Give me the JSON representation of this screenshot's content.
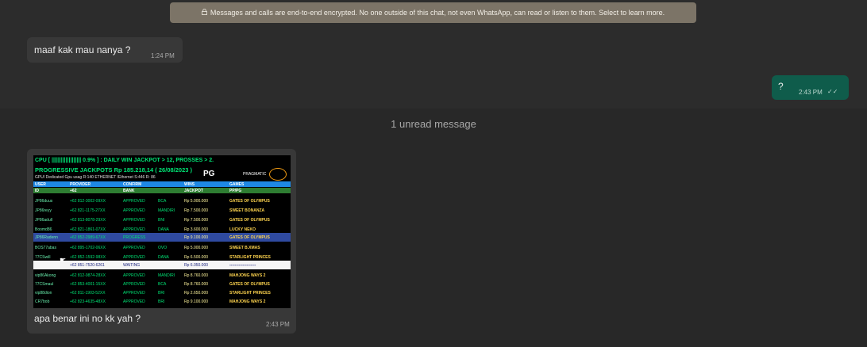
{
  "system_banner": "Messages and calls are end-to-end encrypted. No one outside of this chat, not even WhatsApp, can read or listen to them. Select to learn more.",
  "messages": {
    "m1": {
      "text": "maaf kak mau nanya ?",
      "time": "1:24 PM"
    },
    "m2": {
      "text": "?",
      "time": "2:43 PM"
    },
    "m3": {
      "caption": "apa benar ini no kk yah ?",
      "time": "2:43 PM"
    }
  },
  "unread_label": "1 unread message",
  "image": {
    "cpu_line": "CPU [ ||||||||||||||||||| 0.9% ]   : DAILY WIN JACKPOT > 12, PROSSES > 2.",
    "progressive": "PROGRESSIVE JACKPOTS   Rp 185.218,14  ( 26/08/2023 )",
    "gpu_line": "GPU/ Dedicated Gpu usag R:140      ETHERNET /Ethernet S:446 R: 86",
    "pg_logo": "PG",
    "pragmatic": "PRAGMATIC",
    "columns1": [
      "USER",
      "PROVIDER",
      "CONFIRM",
      "WINS",
      "GAMES"
    ],
    "columns2": [
      "ID",
      "+62",
      "BANK",
      "JACKPOT",
      "PP/PG"
    ],
    "rows": [
      [
        "JP86duus",
        "+62 812-3002-09XX",
        "APPROVED",
        "BCA",
        "Rp 5.000.000",
        "GATES OF OLYMPUS"
      ],
      [
        "JP86reyy",
        "+62 821-1175-27XX",
        "APPROVED",
        "MANDIRI",
        "Rp 7.500.000",
        "SWEET BONANZA"
      ],
      [
        "JP86adull",
        "+62 813-8078-29XX",
        "APPROVED",
        "BNI",
        "Rp 7.500.000",
        "GATES OF OLYMPUS"
      ],
      [
        "Boomd86",
        "+62 821-1861-07XX",
        "APPROVED",
        "DANA",
        "Rp 3.600.000",
        "LUCKY NEKO"
      ],
      [
        "JP86Radenn",
        "+62 852-2989-67XX",
        "PROGRESS",
        "",
        "Rp 9.100.000",
        "GATES OF OLYMPUS"
      ],
      [
        "BOS77abas",
        "+62 895-1702-06XX",
        "APPROVED",
        "OVO",
        "Rp 5.000.000",
        "SWEET B.XMAS"
      ],
      [
        "77CSwill",
        "+62 852-1592-98XX",
        "APPROVED",
        "DANA",
        "Rp 6.500.000",
        "STARLIGHT PRINCES"
      ],
      [
        "",
        "+62 851-7520-6261",
        "WAITING",
        "",
        "Rp 6.050.000",
        "--------------------"
      ],
      [
        "vip86Akong",
        "+62 812-9874-28XX",
        "APPROVED",
        "MANDIRI",
        "Rp 8.760.000",
        "MAHJONG WAYS 2"
      ],
      [
        "77CSmaul",
        "+62 853-4001-15XX",
        "APPROVED",
        "BCA",
        "Rp 8.760.000",
        "GATES OF OLYMPUS"
      ],
      [
        "vip88dion",
        "+62 811-1903-52XX",
        "APPROVED",
        "BRI",
        "Rp 2.650.000",
        "STARLIGHT PRINCES"
      ],
      [
        "CR7bob",
        "+62 823-4635-48XX",
        "APPROVED",
        "BRI",
        "Rp 9.100.000",
        "MAHJONG WAYS 2"
      ]
    ]
  }
}
